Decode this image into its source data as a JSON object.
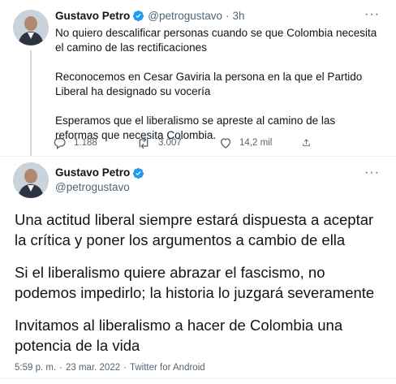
{
  "tweet1": {
    "name": "Gustavo Petro",
    "handle": "@petrogustavo",
    "dot": "·",
    "time": "3h",
    "paragraphs": [
      "No quiero descalificar personas cuando se que Colombia necesita el camino de las rectificaciones",
      "Reconocemos en Cesar Gaviria la persona en la que el Partido Liberal ha designado su vocería",
      "Esperamos que el liberalismo se apreste al camino de las reformas que necesita Colombia."
    ],
    "replies": "1.188",
    "retweets": "3.007",
    "likes": "14,2 mil",
    "icons": [
      "reply-icon",
      "retweet-icon",
      "like-icon",
      "share-icon",
      "more-icon",
      "verified-icon"
    ]
  },
  "tweet2": {
    "name": "Gustavo Petro",
    "handle": "@petrogustavo",
    "paragraphs": [
      "Una actitud liberal siempre estará dispuesta a aceptar la crítica y poner los argumentos a cambio de ella",
      "Si el liberalismo quiere abrazar el fascismo, no podemos impedirlo; la historia lo juzgará severamente",
      "Invitamos al liberalismo a hacer de Colombia una potencia de la vida"
    ],
    "time": "5:59 p. m.",
    "dot": "·",
    "date": "23 mar. 2022",
    "source": "Twitter for Android"
  },
  "colors": {
    "accent": "#1d9bf0",
    "secondary": "#536471",
    "border": "#eff3f4"
  }
}
